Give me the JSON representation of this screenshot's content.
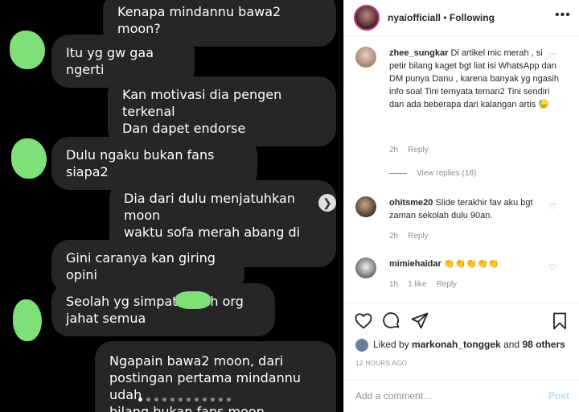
{
  "chat": {
    "messages": [
      {
        "text": "Kenapa mindannu bawa2 moon?"
      },
      {
        "text": "Itu yg gw gaa ngerti"
      },
      {
        "text": "Kan motivasi dia pengen terkenal\nDan dapet endorse"
      },
      {
        "text": "Dulu ngaku bukan fans siapa2"
      },
      {
        "text": "Dia dari dulu menjatuhkan moon\nwaktu sofa merah abang di post"
      },
      {
        "text": "Gini caranya kan giring opini"
      },
      {
        "text": "Seolah yg simpati          a tuh org\njahat semua"
      },
      {
        "text": "Ngapain bawa2 moon, dari\npostingan pertama mindannu udah\nbilang bukan fans moon"
      }
    ],
    "next_glyph": "❯"
  },
  "post": {
    "header": {
      "username": "nyaiofficiall",
      "separator": " • ",
      "follow_label": "Following",
      "more_glyph": "•••"
    },
    "comments": [
      {
        "username": "zhee_sungkar",
        "text": "Di artikel mic merah , si petir bilang kaget bgt liat isi WhatsApp dan DM punya Danu , karena banyak yg ngasih info soal Tini ternyata teman2 Tini sendiri dan ada beberapa dari kalangan artis 😓",
        "time": "2h",
        "likes": "",
        "reply": "Reply",
        "view_replies": "View replies (18)"
      },
      {
        "username": "ohitsme20",
        "text": "Slide terakhir fav aku bgt zaman sekolah dulu 90an.",
        "time": "2h",
        "likes": "",
        "reply": "Reply"
      },
      {
        "username": "mimiehaidar",
        "text": "👏👏👏👏👏",
        "time": "1h",
        "likes": "1 like",
        "reply": "Reply"
      }
    ],
    "likes": {
      "prefix": "Liked by ",
      "user": "markonah_tonggek",
      "mid": " and ",
      "others": "98 others"
    },
    "timestamp": "12 HOURS AGO",
    "add_comment": {
      "placeholder": "Add a comment…",
      "post_label": "Post"
    }
  }
}
